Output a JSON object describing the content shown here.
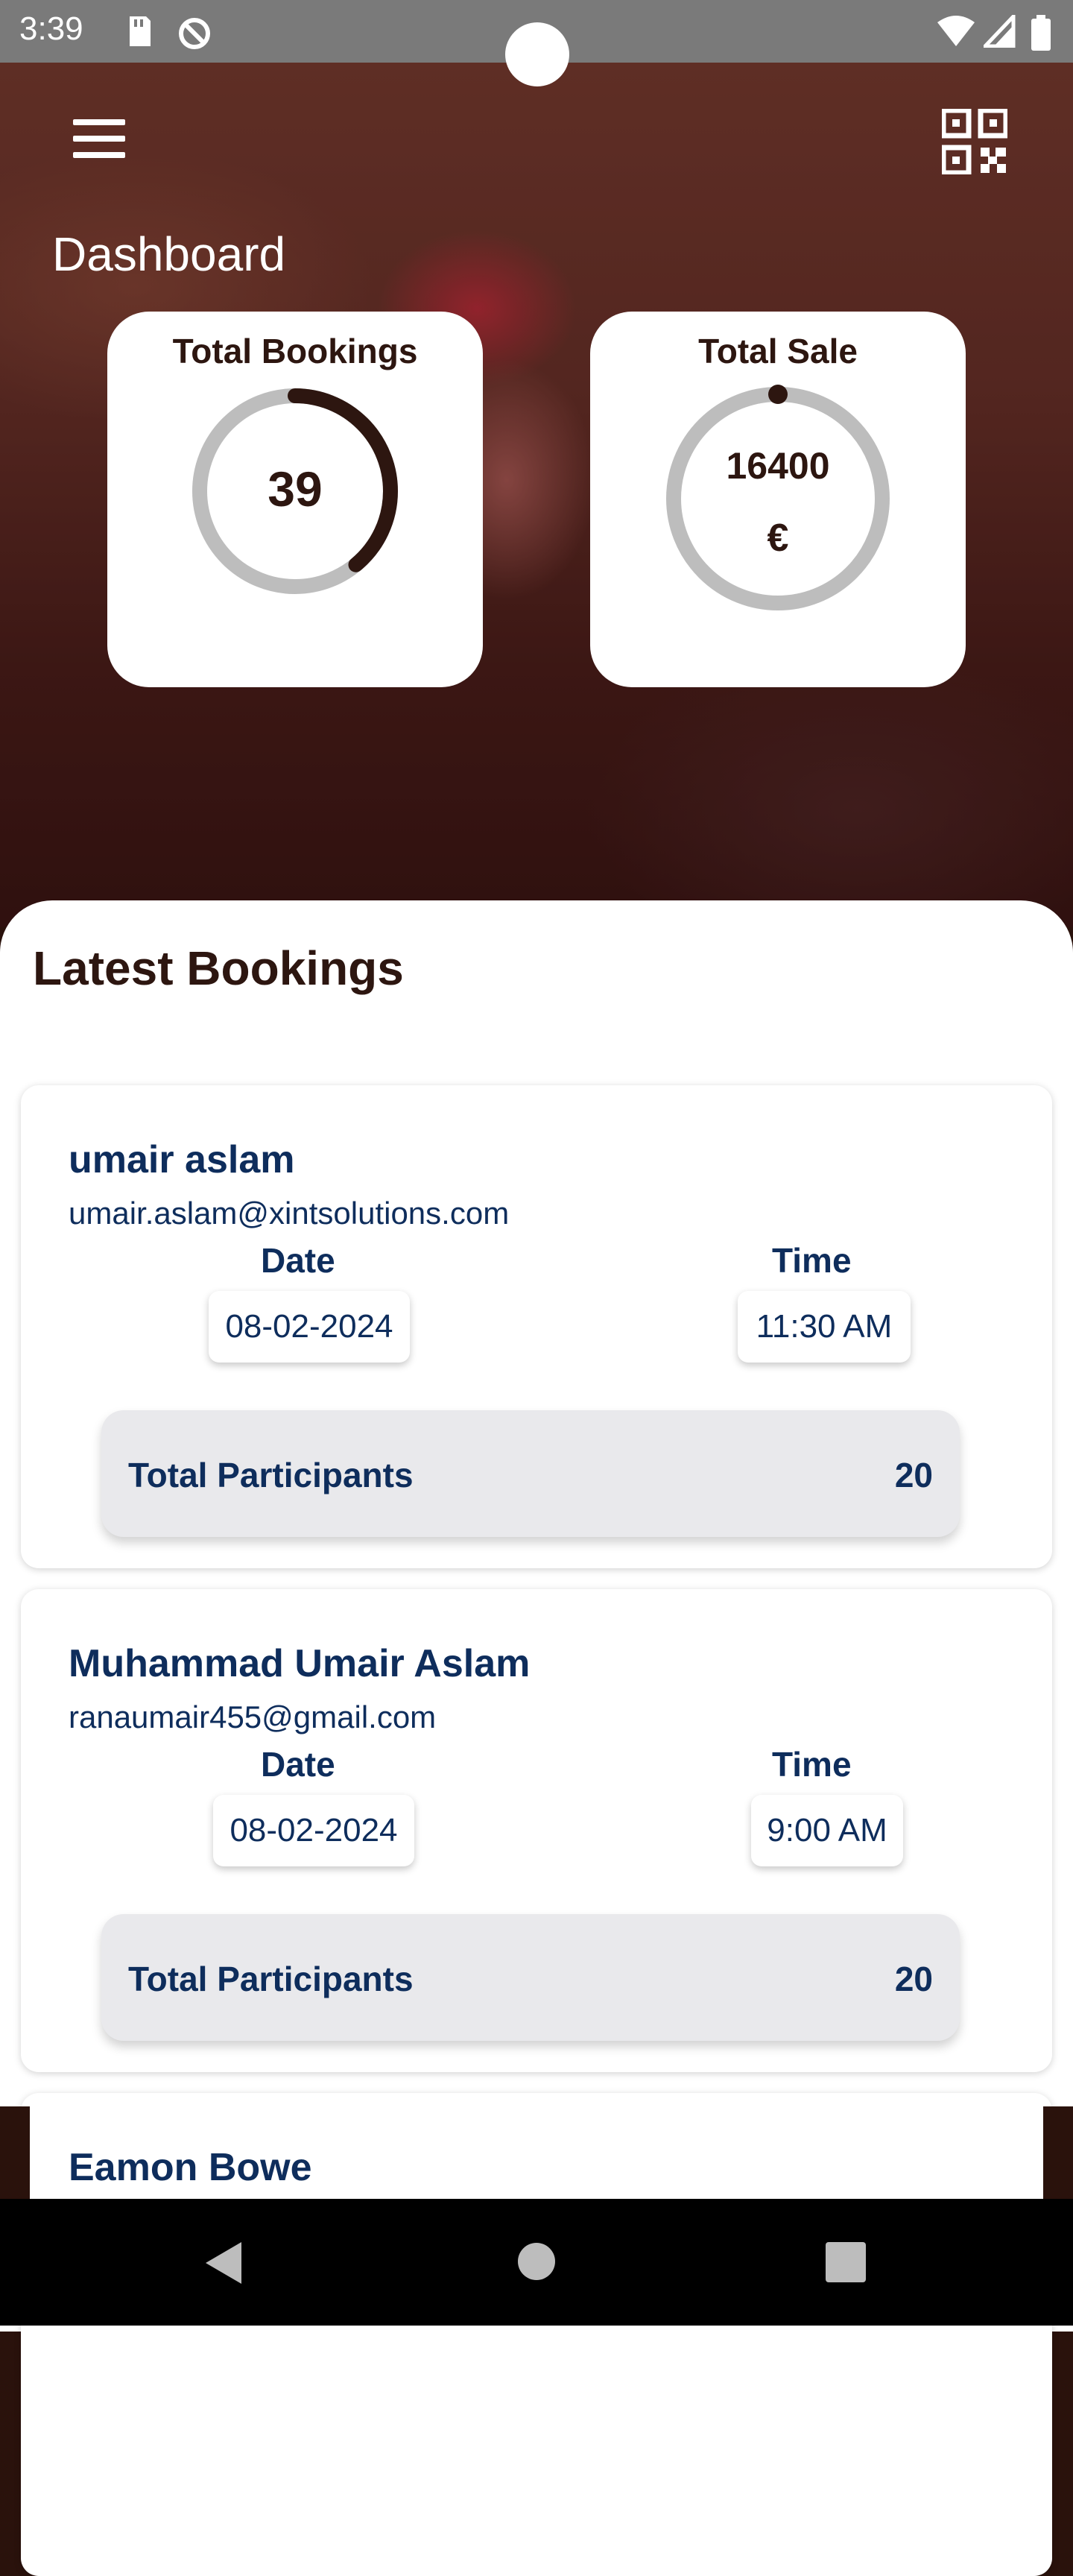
{
  "status_bar": {
    "time": "3:39",
    "left_icons": [
      "sd-card-icon",
      "no-sync-icon"
    ],
    "right_icons": [
      "wifi-icon",
      "signal-icon",
      "battery-icon"
    ]
  },
  "header": {
    "title": "Dashboard",
    "menu_icon": "hamburger-menu-icon",
    "qr_icon": "qr-code-icon"
  },
  "stats": {
    "total_bookings": {
      "label": "Total Bookings",
      "value": "39",
      "progress": 0.39
    },
    "total_sale": {
      "label": "Total Sale",
      "value": "16400",
      "currency": "€",
      "progress": 0.0
    }
  },
  "latest": {
    "title": "Latest Bookings",
    "date_label": "Date",
    "time_label": "Time",
    "participants_label": "Total Participants",
    "bookings": [
      {
        "name": "umair aslam",
        "email": "umair.aslam@xintsolutions.com",
        "date": "08-02-2024",
        "time": "11:30 AM",
        "participants": "20"
      },
      {
        "name": "Muhammad Umair Aslam",
        "email": "ranaumair455@gmail.com",
        "date": "08-02-2024",
        "time": "9:00 AM",
        "participants": "20"
      },
      {
        "name": "Eamon Bowe"
      }
    ]
  },
  "nav": {
    "icons": [
      "back-icon",
      "home-icon",
      "recents-icon"
    ]
  },
  "colors": {
    "primary_text": "#0e2d5c",
    "dark_brown": "#2d1610",
    "ring_track": "#bdbdbd",
    "chip_bg": "#e9e9ec"
  }
}
